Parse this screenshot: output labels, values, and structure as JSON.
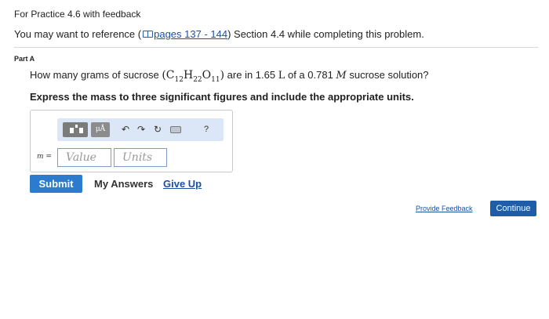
{
  "header": {
    "title": "For Practice 4.6 with feedback",
    "ref_prefix": "You may want to reference (",
    "ref_link": "pages 137 - 144",
    "ref_suffix": ") Section 4.4 while completing this problem."
  },
  "part": {
    "label": "Part A"
  },
  "question": {
    "text_before": "How many grams of sucrose ",
    "formula_open": "(C",
    "sub1": "12",
    "formula_h": "H",
    "sub2": "22",
    "formula_o": "O",
    "sub3": "11",
    "formula_close": ")",
    "text_middle": " are in 1.65 ",
    "unit_L": "L",
    "text_middle2": " of a 0.781 ",
    "unit_M": "M",
    "text_after": " sucrose solution?"
  },
  "instruction": "Express the mass to three significant figures and include the appropriate units.",
  "toolbar": {
    "units_label": "μÅ",
    "undo_glyph": "↶",
    "redo_glyph": "↷",
    "reset_glyph": "↻",
    "help_label": "?",
    "icons": [
      "templates-icon",
      "units-icon",
      "undo-icon",
      "redo-icon",
      "reset-icon",
      "keyboard-icon",
      "help-icon"
    ]
  },
  "answer": {
    "variable": "m",
    "equals": " =",
    "value_placeholder": "Value",
    "units_placeholder": "Units"
  },
  "actions": {
    "submit": "Submit",
    "my_answers": "My Answers",
    "give_up": "Give Up"
  },
  "footer": {
    "provide_feedback": "Provide Feedback",
    "continue": "Continue"
  },
  "colors": {
    "submit_bg": "#2c7bcd",
    "continue_bg": "#1f5da8",
    "link": "#1f4fa3",
    "toolbar_bg": "#dbe7f6"
  }
}
